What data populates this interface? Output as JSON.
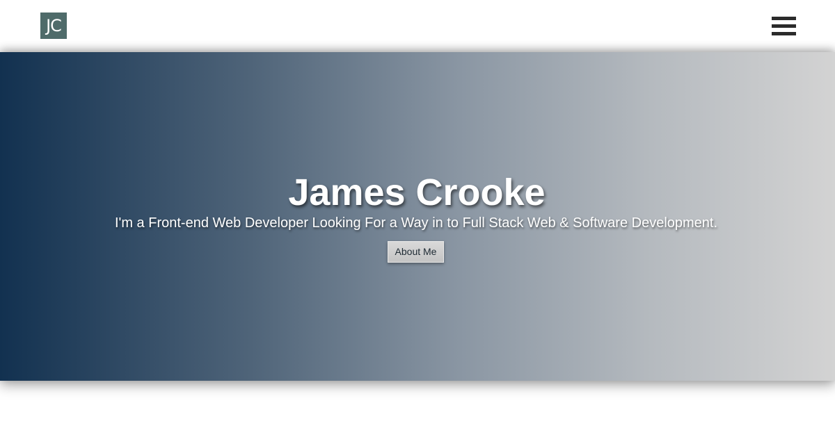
{
  "header": {
    "logo_text": "JC",
    "menu_icon": "hamburger-menu-icon"
  },
  "hero": {
    "title": "James Crooke",
    "subtitle": "I'm a Front-end Web Developer Looking For a Way in to Full Stack Web & Software Development.",
    "cta_label": "About Me",
    "gradient_start": "#123150",
    "gradient_end": "#d3d3d3"
  },
  "colors": {
    "logo_bg": "#4f6b6a",
    "menu_bars": "#2b2b2b",
    "text_light": "#ffffff"
  }
}
